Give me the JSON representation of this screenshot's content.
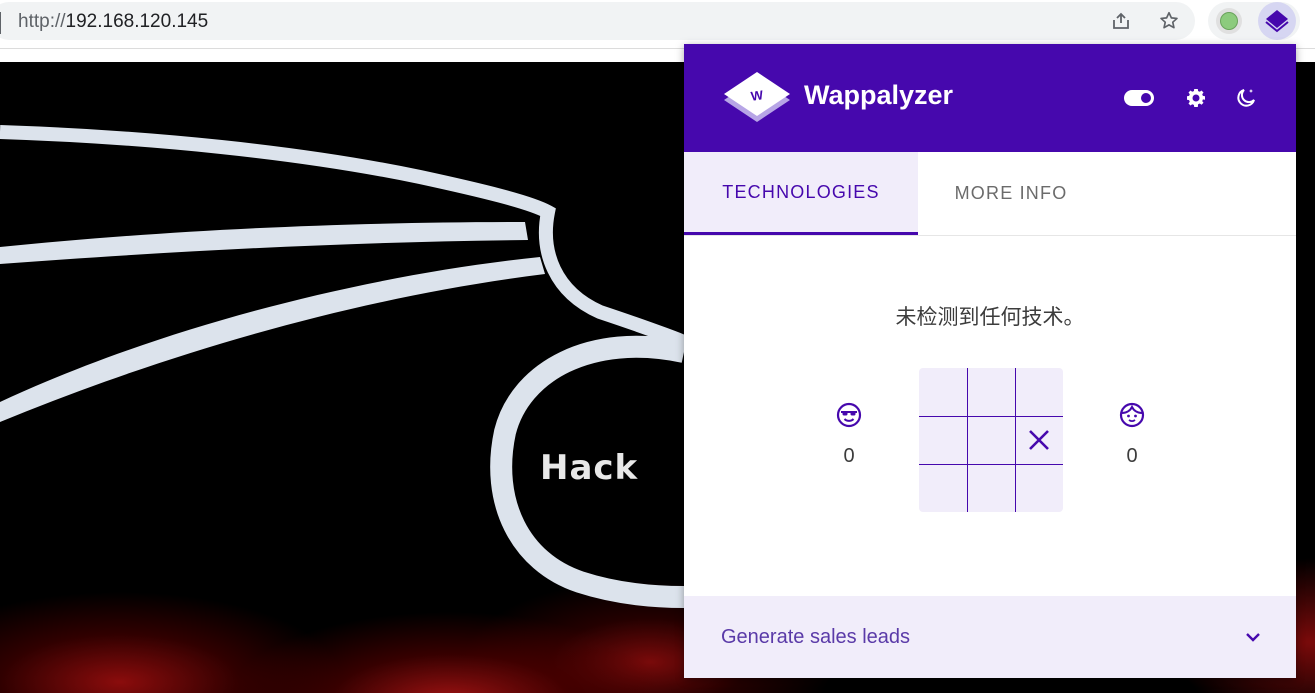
{
  "browser": {
    "url_scheme": "http://",
    "url_host": "192.168.120.145",
    "icons": [
      "share-icon",
      "star-icon",
      "extension-icon",
      "wappalyzer-extension-icon"
    ]
  },
  "page": {
    "hack_text": "Hack"
  },
  "wappalyzer": {
    "brand": "Wappalyzer",
    "header_icons": [
      "toggle-icon",
      "gear-icon",
      "moon-icon"
    ],
    "tabs": [
      {
        "label": "TECHNOLOGIES",
        "active": true
      },
      {
        "label": "MORE INFO",
        "active": false
      }
    ],
    "empty_message": "未检测到任何技术。",
    "game": {
      "player_score": "0",
      "opponent_score": "0",
      "board": [
        "",
        "",
        "",
        "",
        "",
        "X",
        "",
        "",
        ""
      ]
    },
    "footer_label": "Generate sales leads"
  },
  "colors": {
    "brand_purple": "#4608ad",
    "tab_bg": "#f1edfa"
  }
}
